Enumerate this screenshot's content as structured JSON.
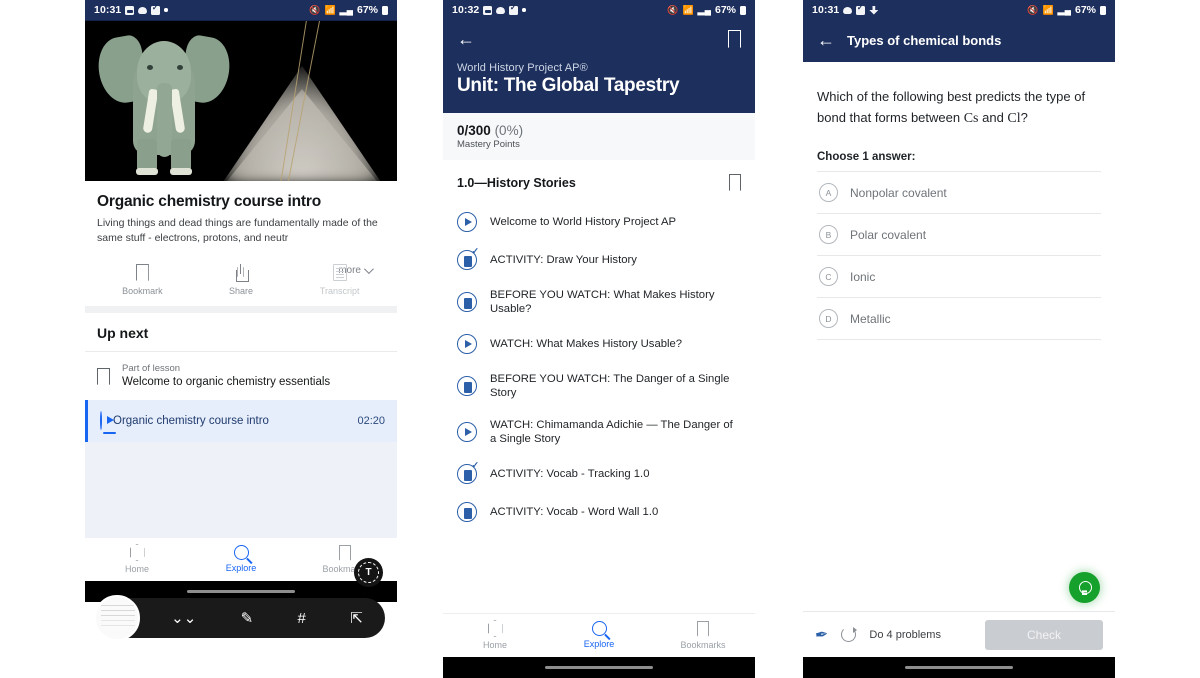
{
  "panel1": {
    "status": {
      "time": "10:31",
      "battery": "67%",
      "left_icons": [
        "gallery-icon",
        "cloud-icon",
        "task-check-icon",
        "dot-icon"
      ],
      "right_icons": [
        "mute-icon",
        "wifi-icon",
        "signal-icon",
        "battery-icon"
      ]
    },
    "video": {
      "title": "Organic chemistry course intro",
      "description": "Living things and dead things are fundamentally made of the same stuff - electrons, protons, and neutr",
      "more_label": "more",
      "thumbnail_alt": "elephant-and-pyramid-illustration"
    },
    "actions": [
      {
        "label": "Bookmark",
        "icon": "bookmark-icon",
        "disabled": false
      },
      {
        "label": "Share",
        "icon": "share-icon",
        "disabled": false
      },
      {
        "label": "Transcript",
        "icon": "transcript-icon",
        "disabled": true
      }
    ],
    "up_next": {
      "heading": "Up next",
      "lesson_kicker": "Part of lesson",
      "lesson_title": "Welcome to organic chemistry essentials",
      "active_item": {
        "title": "Organic chemistry course intro",
        "duration": "02:20"
      }
    },
    "capture_toolbar": {
      "fab_icon": "text-extract-icon",
      "items": [
        "screenshot-thumbnail",
        "scroll-capture-icon",
        "crop-edit-icon",
        "tags-icon",
        "share-icon"
      ]
    },
    "nav": [
      {
        "label": "Home",
        "icon": "home-hexagon-icon",
        "active": false
      },
      {
        "label": "Explore",
        "icon": "search-icon",
        "active": true
      },
      {
        "label": "Bookmarks",
        "icon": "bookmark-icon",
        "active": false
      }
    ]
  },
  "panel2": {
    "status": {
      "time": "10:32",
      "battery": "67%"
    },
    "header": {
      "back_icon": "back-arrow-icon",
      "bookmark_icon": "bookmark-icon",
      "course": "World History Project AP®",
      "unit_title": "Unit: The Global Tapestry"
    },
    "mastery": {
      "score": "0/300",
      "percent": "(0%)",
      "label": "Mastery Points"
    },
    "section": {
      "title": "1.0—History Stories",
      "bookmark_icon": "bookmark-icon"
    },
    "items": [
      {
        "label": "Welcome to World History Project AP",
        "type": "video"
      },
      {
        "label": "ACTIVITY: Draw Your History",
        "type": "exercise"
      },
      {
        "label": "BEFORE YOU WATCH: What Makes History Usable?",
        "type": "article"
      },
      {
        "label": "WATCH: What Makes History Usable?",
        "type": "video"
      },
      {
        "label": "BEFORE YOU WATCH: The Danger of a Single Story",
        "type": "article"
      },
      {
        "label": "WATCH: Chimamanda Adichie — The Danger of a Single Story",
        "type": "video"
      },
      {
        "label": "ACTIVITY: Vocab - Tracking 1.0",
        "type": "exercise"
      },
      {
        "label": "ACTIVITY: Vocab - Word Wall 1.0",
        "type": "article"
      }
    ],
    "nav": [
      {
        "label": "Home",
        "icon": "home-hexagon-icon",
        "active": false
      },
      {
        "label": "Explore",
        "icon": "search-icon",
        "active": true
      },
      {
        "label": "Bookmarks",
        "icon": "bookmark-icon",
        "active": false
      }
    ]
  },
  "panel3": {
    "status": {
      "time": "10:31",
      "battery": "67%"
    },
    "header": {
      "back_icon": "back-arrow-icon",
      "title": "Types of chemical bonds"
    },
    "question": {
      "part1": "Which of the following best predicts the type of bond that forms between ",
      "var1": "Cs",
      "part2": " and ",
      "var2": "Cl",
      "part3": "?"
    },
    "choose_label": "Choose 1 answer:",
    "choices": [
      {
        "key": "A",
        "label": "Nonpolar covalent"
      },
      {
        "key": "B",
        "label": "Polar covalent"
      },
      {
        "key": "C",
        "label": "Ionic"
      },
      {
        "key": "D",
        "label": "Metallic"
      }
    ],
    "hint_fab": {
      "icon": "lightbulb-icon",
      "color": "#16a02c"
    },
    "footer": {
      "scratchpad_icon": "scratchpad-pen-icon",
      "reset_icon": "refresh-icon",
      "progress_label": "Do 4 problems",
      "check_label": "Check"
    }
  }
}
